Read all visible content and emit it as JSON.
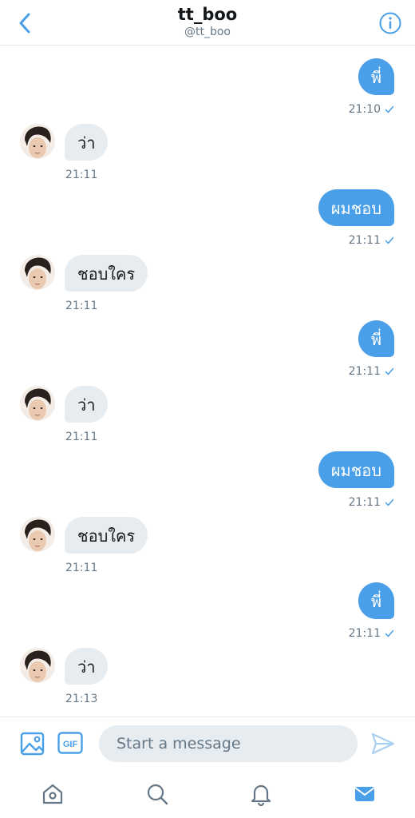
{
  "header": {
    "title": "tt_boo",
    "handle": "@tt_boo"
  },
  "messages": [
    {
      "direction": "out",
      "text": "พี่",
      "time": "21:10"
    },
    {
      "direction": "in",
      "text": "ว่า",
      "time": "21:11"
    },
    {
      "direction": "out",
      "text": "ผมชอบ",
      "time": "21:11"
    },
    {
      "direction": "in",
      "text": "ชอบใคร",
      "time": "21:11"
    },
    {
      "direction": "out",
      "text": "พี่",
      "time": "21:11"
    },
    {
      "direction": "in",
      "text": "ว่า",
      "time": "21:11"
    },
    {
      "direction": "out",
      "text": "ผมชอบ",
      "time": "21:11"
    },
    {
      "direction": "in",
      "text": "ชอบใคร",
      "time": "21:11"
    },
    {
      "direction": "out",
      "text": "พี่",
      "time": "21:11"
    },
    {
      "direction": "in",
      "text": "ว่า",
      "time": "21:13"
    }
  ],
  "composer": {
    "placeholder": "Start a message",
    "gif_label": "GIF"
  },
  "icons": {
    "back": "chevron-left-icon",
    "info": "info-icon",
    "image": "image-icon",
    "gif": "gif-icon",
    "send": "send-icon",
    "home": "home-icon",
    "search": "search-icon",
    "notifications": "bell-icon",
    "messages": "mail-icon"
  },
  "colors": {
    "accent": "#4a9fe9",
    "incoming_bubble": "#e6ecf0",
    "secondary_text": "#657786"
  }
}
